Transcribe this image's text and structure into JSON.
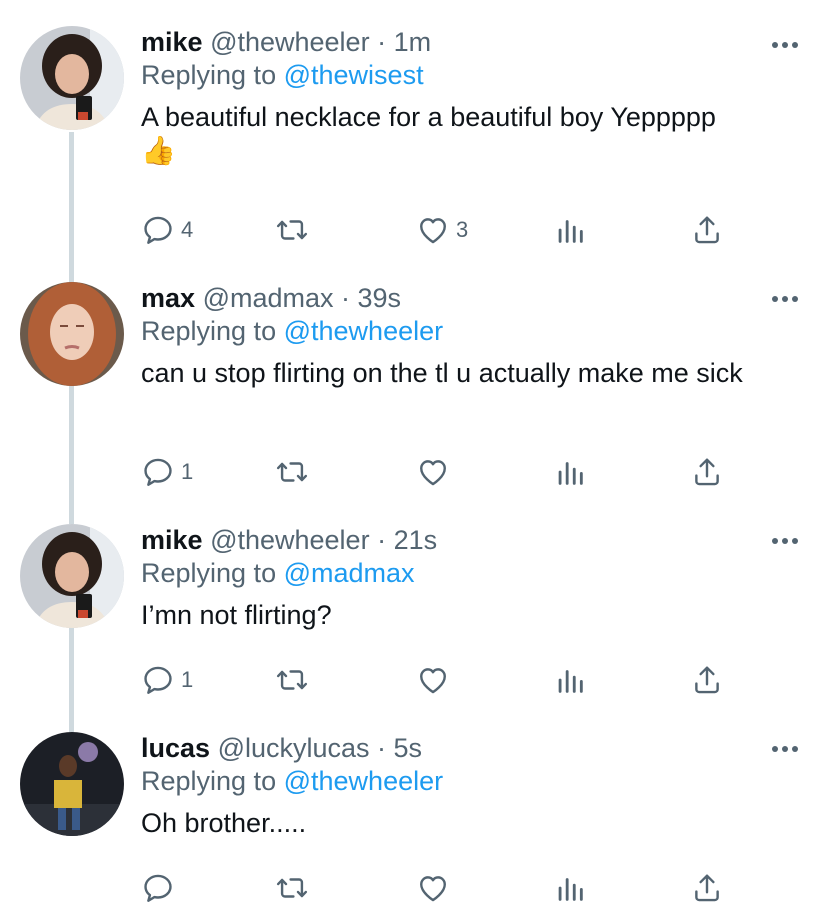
{
  "colors": {
    "accent": "#1d9bf0",
    "muted": "#536471",
    "thread_line": "#cfd9de"
  },
  "tweets": [
    {
      "name": "mike",
      "handle": "@thewheeler",
      "time": "· 1m",
      "replying_label": "Replying to",
      "replying_to": "@thewisest",
      "text": "A beautiful necklace for a beautiful boy Yeppppp",
      "emoji": "👍",
      "counts": {
        "replies": "4",
        "retweets": "",
        "likes": "3"
      }
    },
    {
      "name": "max",
      "handle": "@madmax",
      "time": "· 39s",
      "replying_label": "Replying to",
      "replying_to": "@thewheeler",
      "text": "can u stop flirting on the tl u actually make me sick",
      "counts": {
        "replies": "1",
        "retweets": "",
        "likes": ""
      }
    },
    {
      "name": "mike",
      "handle": "@thewheeler",
      "time": "· 21s",
      "replying_label": "Replying to",
      "replying_to": "@madmax",
      "text": "I’mn not flirting?",
      "counts": {
        "replies": "1",
        "retweets": "",
        "likes": ""
      }
    },
    {
      "name": "lucas",
      "handle": "@luckylucas",
      "time": "· 5s",
      "replying_label": "Replying to",
      "replying_to": "@thewheeler",
      "text": "Oh brother.....",
      "counts": {
        "replies": "",
        "retweets": "",
        "likes": ""
      }
    }
  ],
  "icons": [
    "reply-icon",
    "retweet-icon",
    "like-icon",
    "analytics-icon",
    "share-icon",
    "more-icon"
  ]
}
